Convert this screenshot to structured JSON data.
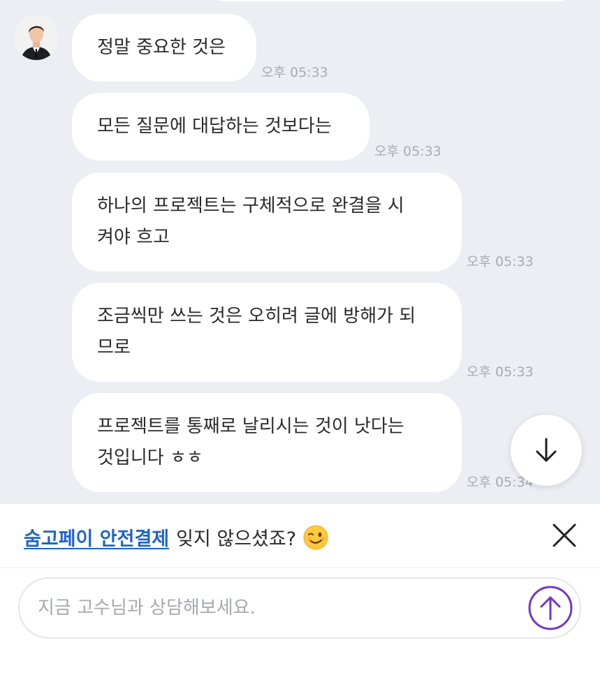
{
  "messages": [
    {
      "text": "정말 중요한 것은",
      "time": "오후 05:33"
    },
    {
      "text": "모든 질문에 대답하는 것보다는",
      "time": "오후 05:33"
    },
    {
      "text": "하나의 프로젝트는 구체적으로 완결을 시\n켜야 흐고",
      "time": "오후 05:33"
    },
    {
      "text": "조금씩만 쓰는 것은 오히려 글에 방해가 되\n므로",
      "time": "오후 05:33"
    },
    {
      "text": "프로젝트를 통째로 날리시는 것이 낫다는\n것입니다 ㅎㅎ",
      "time": "오후 05:34"
    }
  ],
  "banner": {
    "link_text": "숨고페이 안전결제",
    "text": "잊지 않으셨죠?",
    "emoji": "winking-face-emoji"
  },
  "composer": {
    "placeholder": "지금 고수님과 상담해보세요."
  },
  "icons": {
    "scroll_down": "arrow-down-icon",
    "close": "close-icon",
    "send": "arrow-up-circle-icon"
  },
  "colors": {
    "chat_background": "#eceef3",
    "bubble": "#ffffff",
    "link": "#1f63c8",
    "send_accent": "#6e37c8",
    "timestamp": "#a9abb2"
  }
}
